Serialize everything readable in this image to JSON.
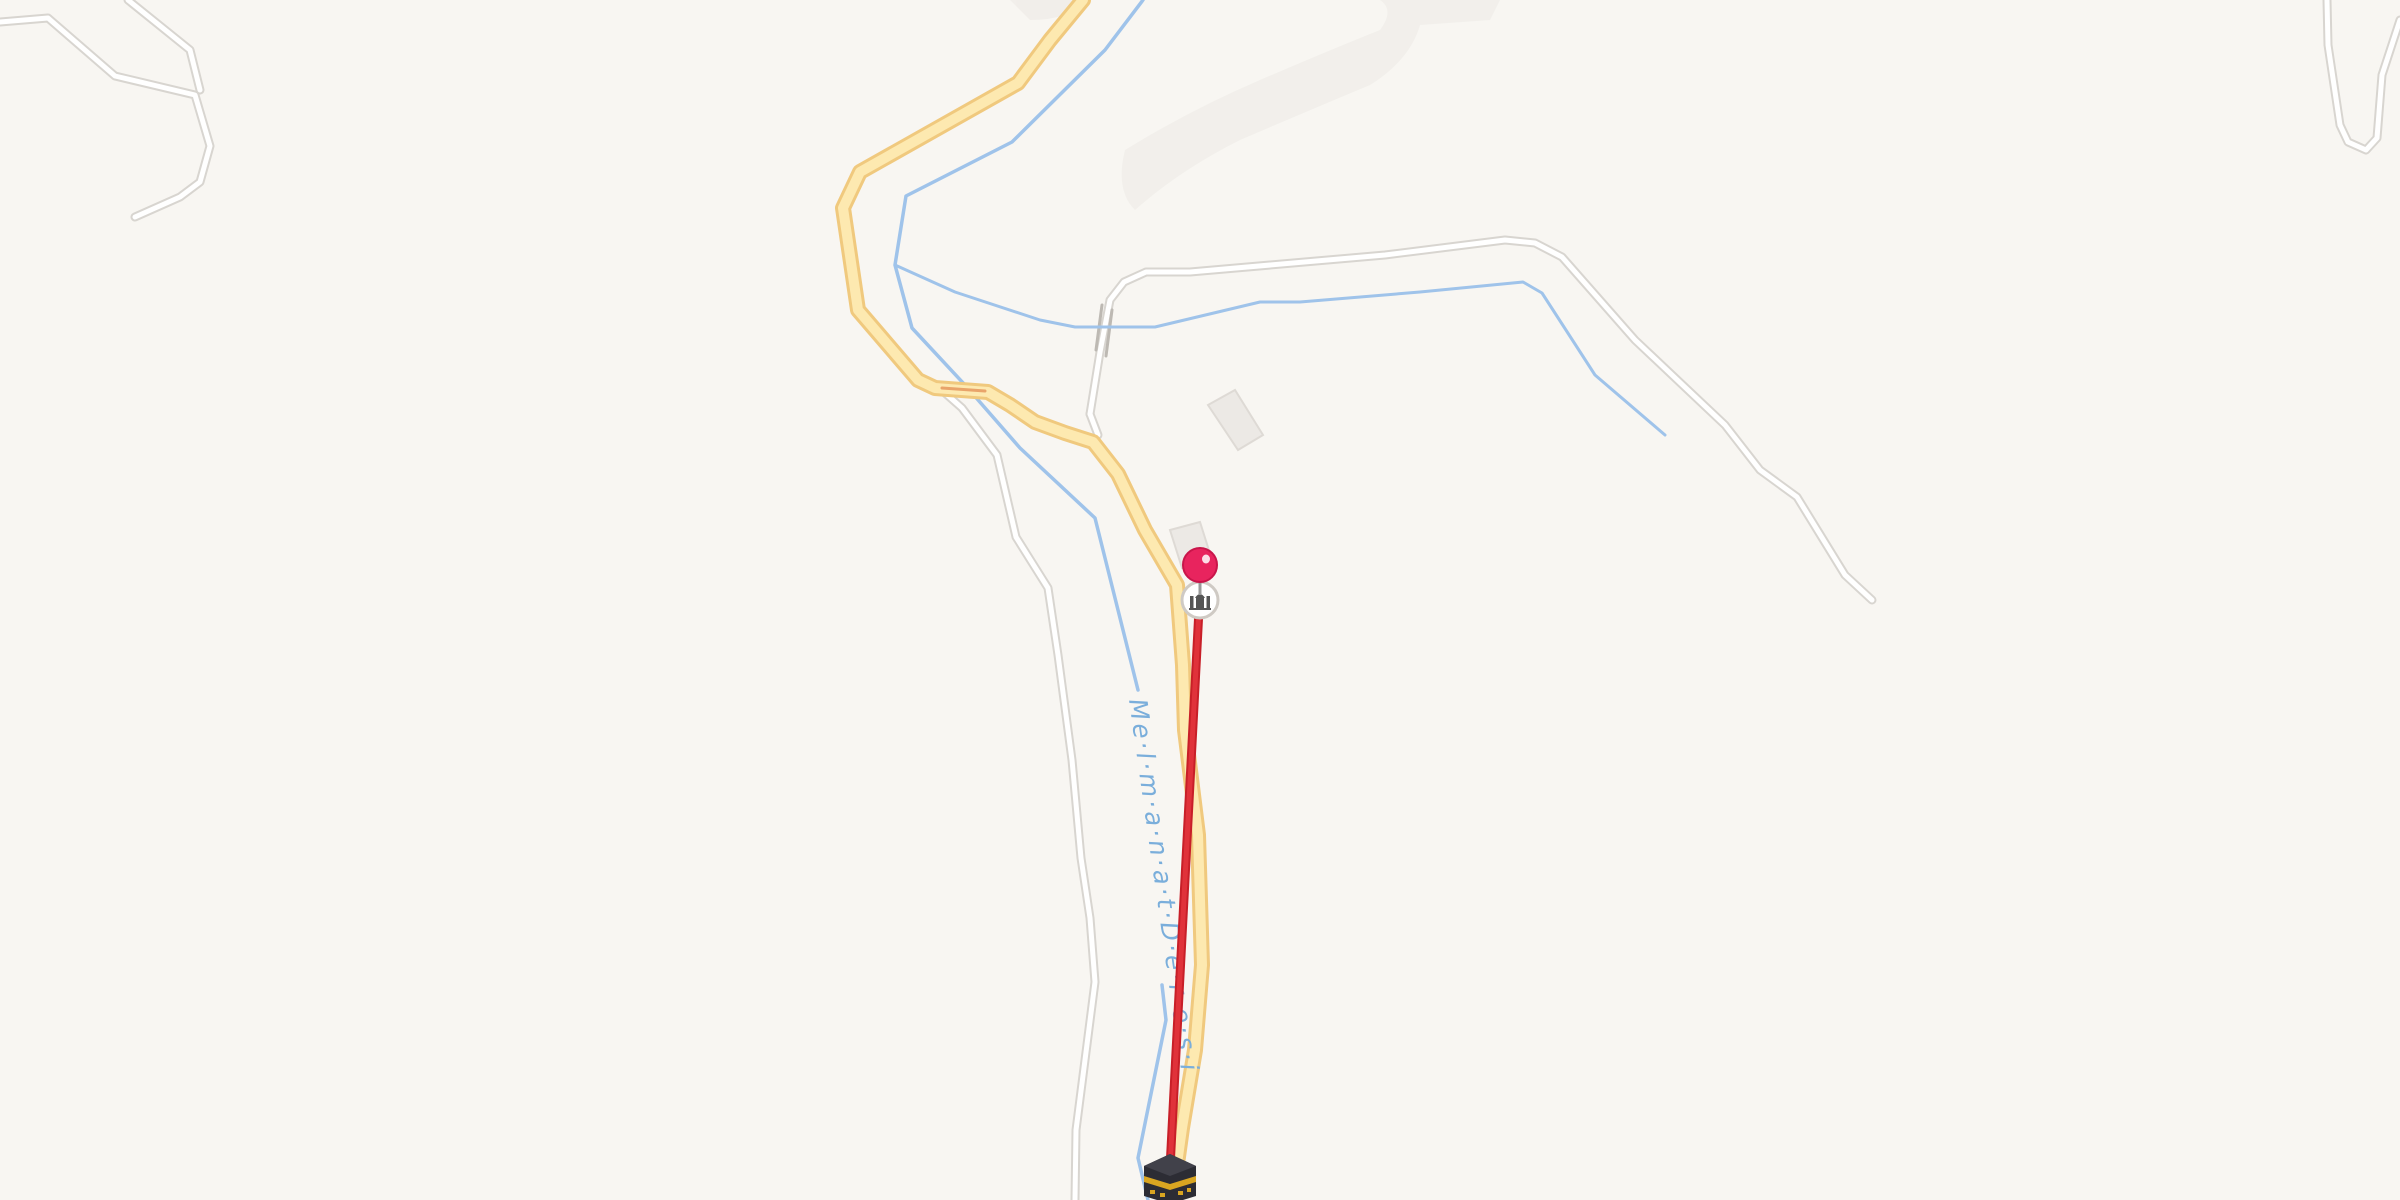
{
  "map": {
    "background_color": "#f8f6f2",
    "road_color_major": "#fde9b0",
    "road_casing_major": "#f0c97e",
    "road_color_minor": "#ffffff",
    "road_casing_minor": "#d8d5d0",
    "water_color": "#9fc3ea",
    "water_label_color": "#7aaedb",
    "building_color": "#ece9e5",
    "qibla_line_color": "#d8262e",
    "pin_color": "#e8245e"
  },
  "labels": {
    "stream_name": "Me·l·m·a·n·a·t·D·e·r·e·s·i"
  },
  "markers": {
    "location_pin": {
      "icon": "map-pin-icon"
    },
    "mosque": {
      "icon": "mosque-icon"
    },
    "kaaba": {
      "icon": "kaaba-icon"
    }
  }
}
